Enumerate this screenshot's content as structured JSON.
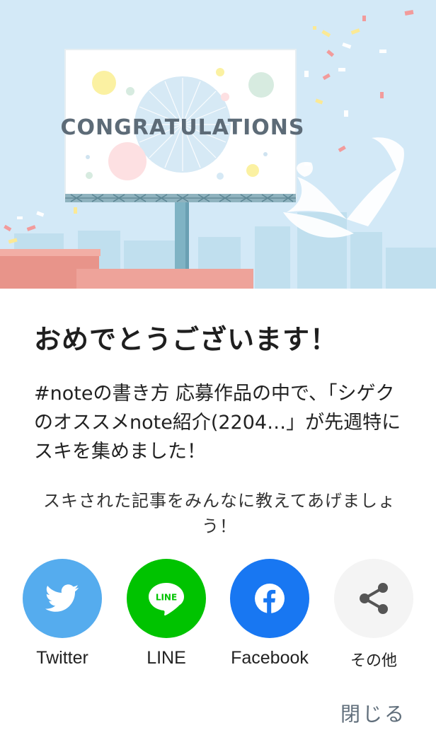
{
  "modal": {
    "banner_text": "CONGRATULATIONS",
    "title": "おめでとうございます！",
    "message": "#noteの書き方 応募作品の中で、「シゲクのオススメnote紹介(2204…」が先週特にスキを集めました！",
    "share_prompt": "スキされた記事をみんなに教えてあげましょう！",
    "close_label": "閉じる"
  },
  "share": [
    {
      "label": "Twitter",
      "icon": "twitter-bird-icon",
      "color": "#55acee"
    },
    {
      "label": "LINE",
      "icon": "line-logo-icon",
      "color": "#00c300",
      "icon_text": "LINE"
    },
    {
      "label": "Facebook",
      "icon": "facebook-logo-icon",
      "color": "#1877f2"
    },
    {
      "label": "その他",
      "icon": "share-icon",
      "color": "#f4f4f4"
    }
  ]
}
